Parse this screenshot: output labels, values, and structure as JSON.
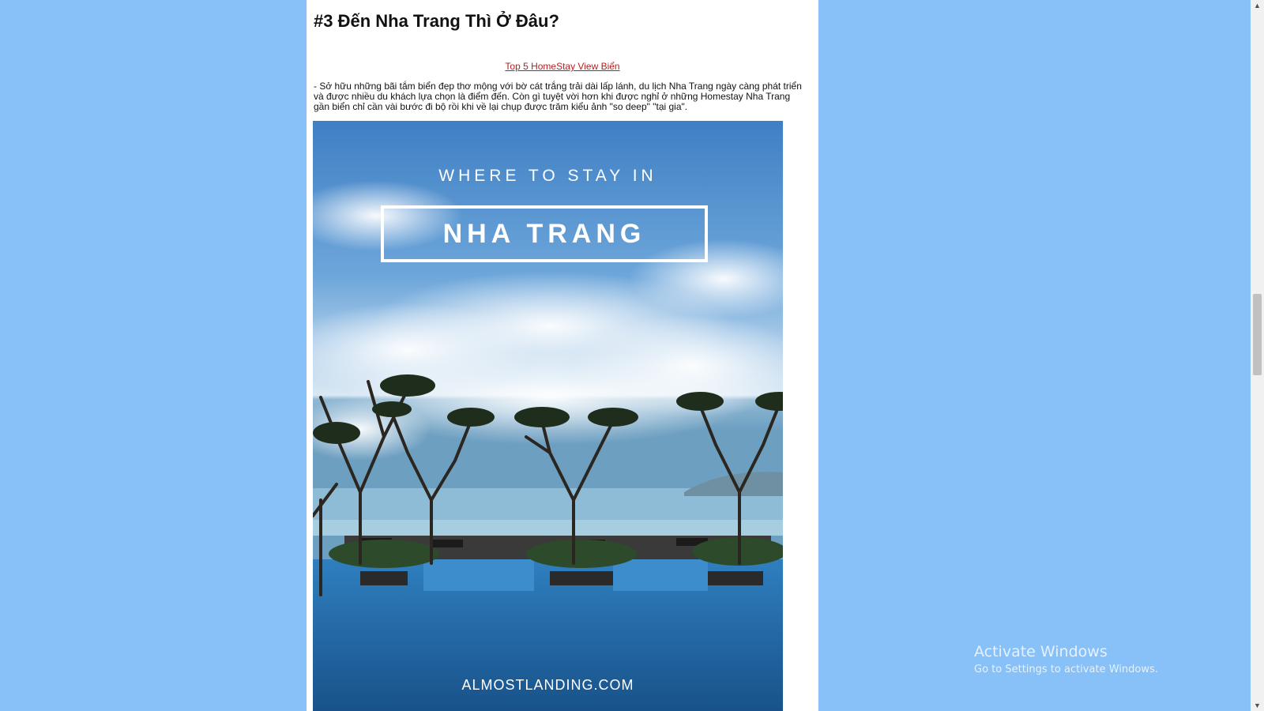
{
  "article": {
    "heading": "#3 Đến Nha Trang Thì Ở Đâu?",
    "link_text": "Top 5 HomeStay View Biển",
    "paragraph": "- Sở hữu những bãi tắm biển đẹp thơ mộng với bờ cát trắng trải dài lấp lánh, du lịch Nha Trang ngày càng phát triển và được nhiều du khách lựa chọn là điểm đến. Còn gì tuyệt vời hơn khi được nghỉ ở những Homestay Nha Trang gần biển chỉ cần vài bước đi bộ rồi khi về lại chụp được trăm kiểu ảnh \"so deep\" \"tại gia\"."
  },
  "hero_image": {
    "tagline": "WHERE TO STAY IN",
    "title": "NHA TRANG",
    "site": "ALMOSTLANDING.COM"
  },
  "scrollbar": {
    "up_icon": "▲",
    "down_icon": "▼"
  },
  "watermark": {
    "title": "Activate Windows",
    "subtitle": "Go to Settings to activate Windows."
  },
  "colors": {
    "background": "#87c1f8",
    "link": "#b51e1e",
    "pool": "#1f6aa6"
  }
}
